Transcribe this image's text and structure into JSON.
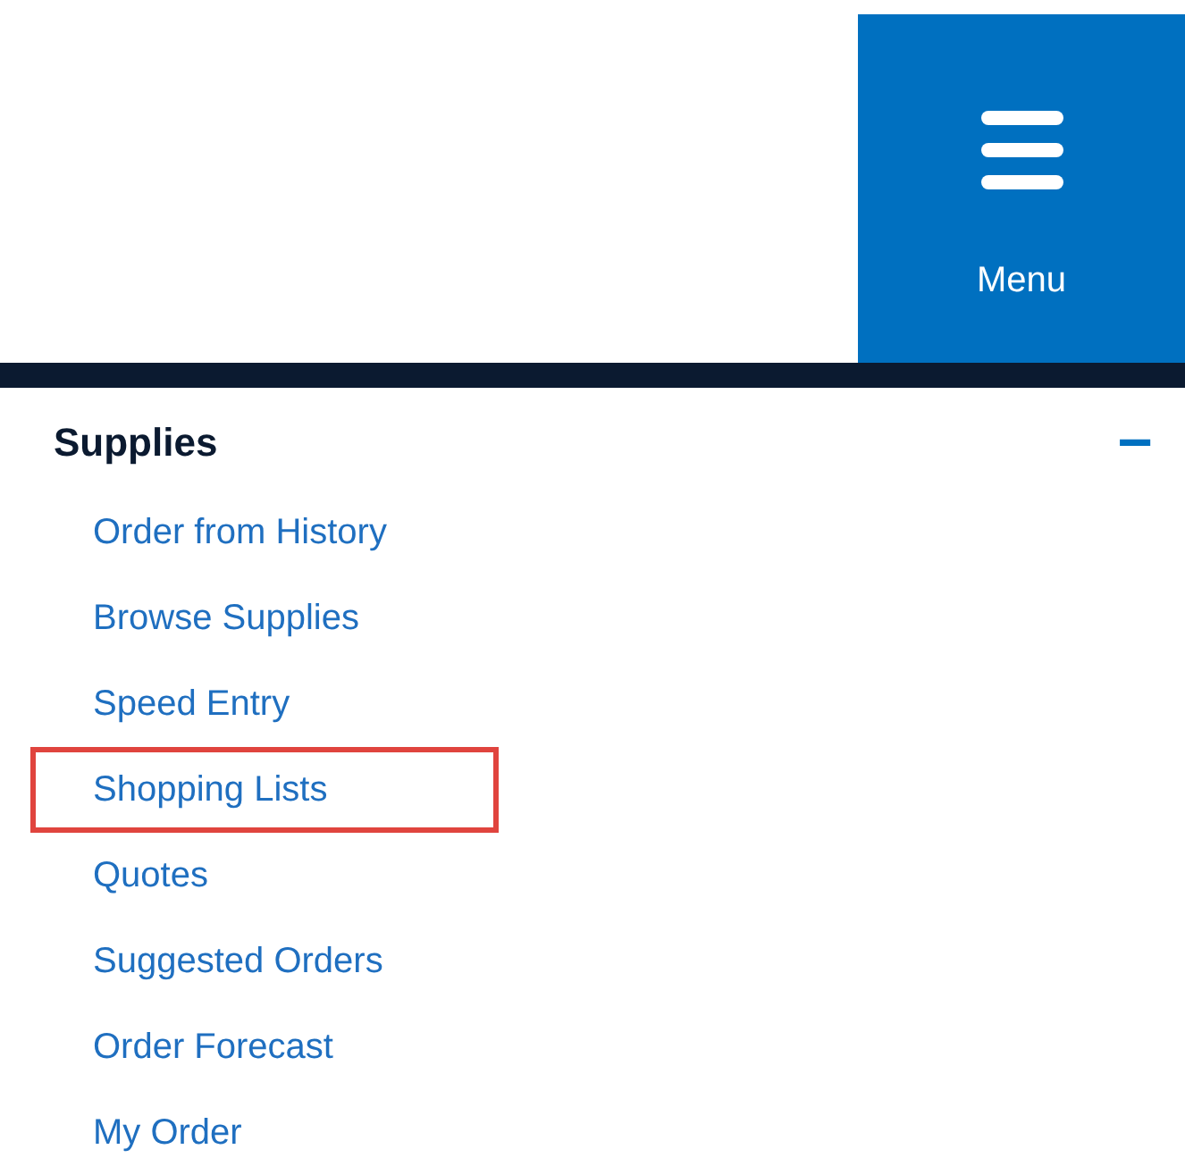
{
  "menu_button": {
    "label": "Menu"
  },
  "section": {
    "title": "Supplies",
    "expanded": true,
    "toggle": "−"
  },
  "items": [
    {
      "label": "Order from History",
      "highlighted": false
    },
    {
      "label": "Browse Supplies",
      "highlighted": false
    },
    {
      "label": "Speed Entry",
      "highlighted": false
    },
    {
      "label": "Shopping Lists",
      "highlighted": true
    },
    {
      "label": "Quotes",
      "highlighted": false
    },
    {
      "label": "Suggested Orders",
      "highlighted": false
    },
    {
      "label": "Order Forecast",
      "highlighted": false
    },
    {
      "label": "My Order",
      "highlighted": false
    }
  ]
}
